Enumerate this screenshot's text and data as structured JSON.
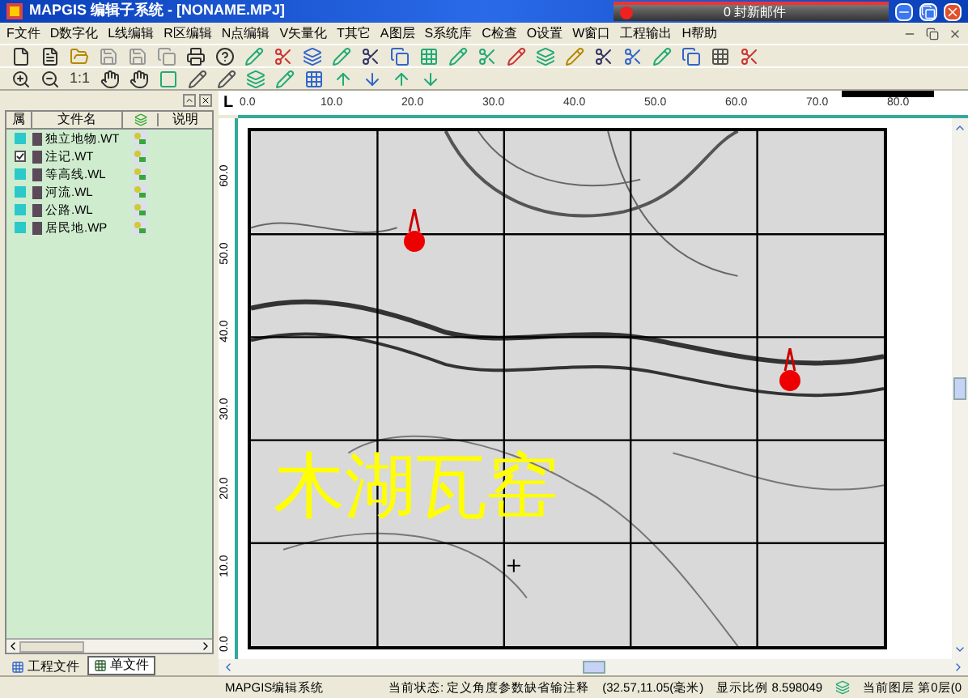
{
  "window": {
    "title": "MAPGIS 编辑子系统 - [NONAME.MPJ]"
  },
  "mail_notice": "0 封新邮件",
  "menu": [
    "F文件",
    "D数字化",
    "L线编辑",
    "R区编辑",
    "N点编辑",
    "V矢量化",
    "T其它",
    "A图层",
    "S系统库",
    "C检查",
    "O设置",
    "W窗口",
    "工程输出",
    "H帮助"
  ],
  "toolbar_text": "1:1",
  "layer_panel": {
    "columns": [
      "属",
      "文件名",
      "说明"
    ],
    "rows": [
      {
        "name": "独立地物.WT",
        "checked": false
      },
      {
        "name": "注记.WT",
        "checked": true
      },
      {
        "name": "等高线.WL",
        "checked": false
      },
      {
        "name": "河流.WL",
        "checked": false
      },
      {
        "name": "公路.WL",
        "checked": false
      },
      {
        "name": "居民地.WP",
        "checked": false
      }
    ]
  },
  "panel_tabs": [
    {
      "label": "工程文件",
      "selected": false
    },
    {
      "label": "单文件",
      "selected": true
    }
  ],
  "ruler": {
    "corner": "L",
    "x_labels": [
      "0.0",
      "10.0",
      "20.0",
      "30.0",
      "40.0",
      "50.0",
      "60.0",
      "70.0",
      "80.0"
    ],
    "y_labels": [
      "60.0",
      "50.0",
      "40.0",
      "30.0",
      "20.0",
      "10.0",
      "0.0"
    ]
  },
  "map": {
    "annotation": "木湖瓦窑"
  },
  "status_bar": {
    "app": "MAPGIS编辑系统",
    "state": "当前状态: 定义角度参数缺省输注释",
    "coords": "(32.57,11.05(毫米)",
    "scale": "显示比例 8.598049",
    "layer": "当前图层 第0层(0"
  }
}
